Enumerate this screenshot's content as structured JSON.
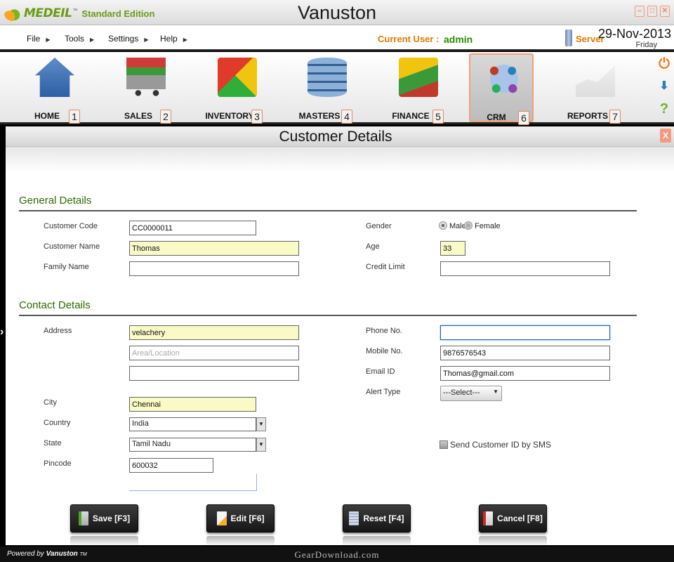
{
  "app": {
    "brand": "MEDEIL",
    "edition": "Standard Edition",
    "title": "Vanuston",
    "tm": "™"
  },
  "window_controls": {
    "minimize": "–",
    "maximize": "□",
    "close": "✕"
  },
  "menu": {
    "items": [
      "File",
      "Tools",
      "Settings",
      "Help"
    ],
    "current_user_label": "Current User :",
    "current_user": "admin",
    "server_label": "Server",
    "date": "29-Nov-2013",
    "day": "Friday"
  },
  "modules": [
    {
      "label": "HOME",
      "key": "1",
      "icon": "home-icon"
    },
    {
      "label": "SALES",
      "key": "2",
      "icon": "cart-icon"
    },
    {
      "label": "INVENTORY",
      "key": "3",
      "icon": "boxes-icon"
    },
    {
      "label": "MASTERS",
      "key": "4",
      "icon": "database-icon"
    },
    {
      "label": "FINANCE",
      "key": "5",
      "icon": "money-icon"
    },
    {
      "label": "CRM",
      "key": "6",
      "icon": "network-icon",
      "active": true
    },
    {
      "label": "REPORTS",
      "key": "7",
      "icon": "chart-icon"
    }
  ],
  "side_icons": {
    "power": "⏻",
    "download": "⬇",
    "help": "?"
  },
  "panel": {
    "title": "Customer Details",
    "close": "X"
  },
  "general": {
    "heading": "General Details",
    "customer_code_label": "Customer Code",
    "customer_code": "CC0000011",
    "customer_name_label": "Customer Name",
    "customer_name": "Thomas",
    "family_name_label": "Family Name",
    "family_name": "",
    "gender_label": "Gender",
    "gender_male": "Male",
    "gender_female": "Female",
    "age_label": "Age",
    "age": "33",
    "credit_limit_label": "Credit Limit",
    "credit_limit": ""
  },
  "contact": {
    "heading": "Contact Details",
    "address_label": "Address",
    "address1": "velachery",
    "address2_placeholder": "Area/Location",
    "address3": "",
    "city_label": "City",
    "city": "Chennai",
    "country_label": "Country",
    "country": "India",
    "state_label": "State",
    "state": "Tamil Nadu",
    "pincode_label": "Pincode",
    "pincode": "600032",
    "phone_label": "Phone No.",
    "phone": "",
    "mobile_label": "Mobile No.",
    "mobile": "9876576543",
    "email_label": "Email ID",
    "email": "Thomas@gmail.com",
    "alert_type_label": "Alert Type",
    "alert_type": "---Select---",
    "sms_label": "Send Customer ID by SMS"
  },
  "buttons": {
    "save": "Save [F3]",
    "edit": "Edit [F6]",
    "reset": "Reset [F4]",
    "cancel": "Cancel [F8]"
  },
  "status": {
    "powered_prefix": "Powered by",
    "powered_brand": "Vanuston",
    "powered_tm": "TM",
    "watermark": "GearDownload.com"
  }
}
